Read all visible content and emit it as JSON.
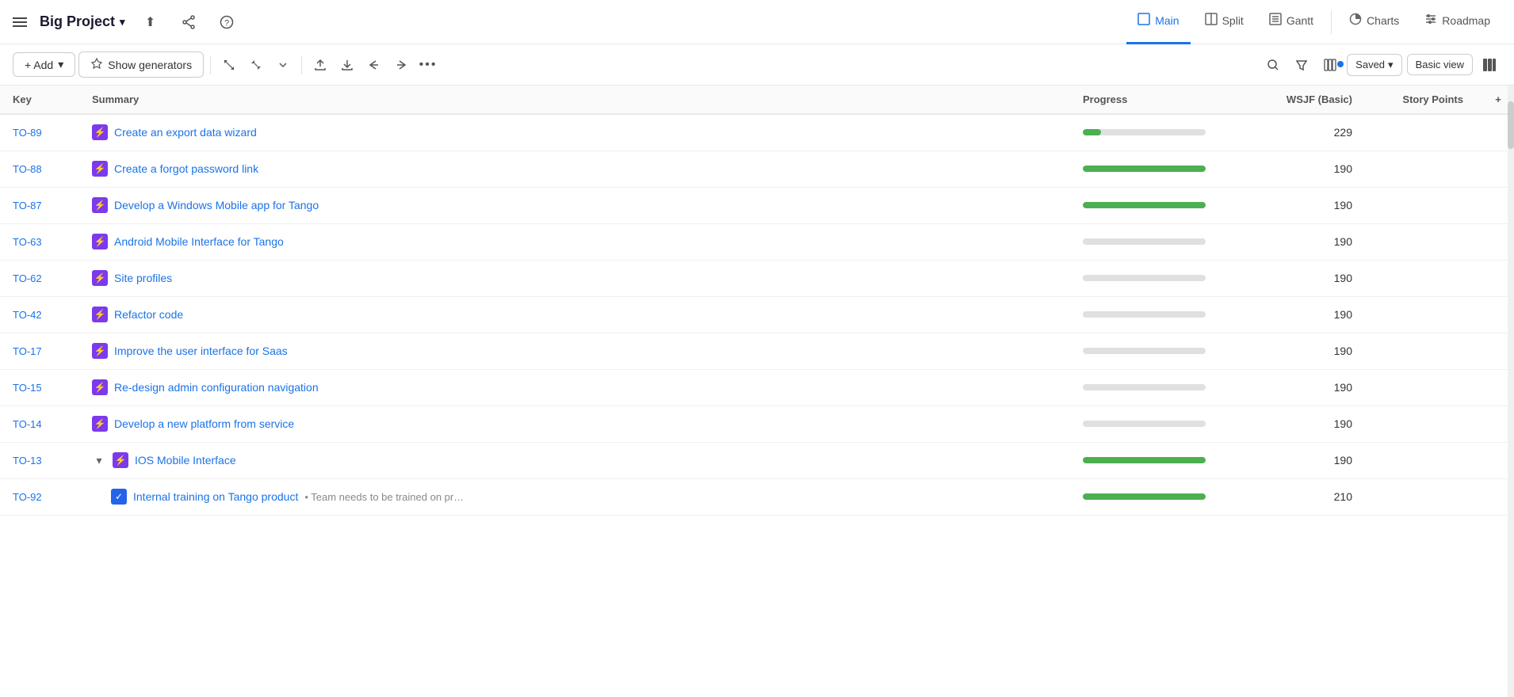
{
  "project": {
    "title": "Big Project",
    "chevron": "▾"
  },
  "topnav": {
    "upload_icon": "⬆",
    "share_icon": "⋮",
    "help_icon": "?",
    "tabs": [
      {
        "id": "main",
        "label": "Main",
        "icon": "☐",
        "active": true
      },
      {
        "id": "split",
        "label": "Split",
        "icon": "⊟",
        "active": false
      },
      {
        "id": "gantt",
        "label": "Gantt",
        "icon": "≡",
        "active": false
      },
      {
        "id": "charts",
        "label": "Charts",
        "icon": "◉",
        "active": false
      },
      {
        "id": "roadmap",
        "label": "Roadmap",
        "icon": "≔",
        "active": false
      }
    ]
  },
  "toolbar": {
    "add_label": "+ Add",
    "add_chevron": "▾",
    "generators_label": "Show generators",
    "expand_icon": "⤢",
    "collapse_icon": "⤡",
    "chevron_down": "▾",
    "upload_icon": "⬆",
    "download_icon": "⬇",
    "back_icon": "◀",
    "forward_icon": "▶",
    "more_icon": "•••",
    "search_icon": "🔍",
    "filter_icon": "⧖",
    "group_icon": "⊞",
    "saved_label": "Saved",
    "saved_chevron": "▾",
    "basic_view_label": "Basic view",
    "columns_icon": "|||"
  },
  "table": {
    "headers": {
      "key": "Key",
      "summary": "Summary",
      "progress": "Progress",
      "wsjf": "WSJF (Basic)",
      "story_points": "Story Points",
      "add": "+"
    },
    "rows": [
      {
        "key": "TO-89",
        "summary": "Create an export data wizard",
        "icon_type": "bolt",
        "progress": 15,
        "wsjf": "229",
        "story_points": "",
        "indent": false,
        "expandable": false,
        "is_subtask": false
      },
      {
        "key": "TO-88",
        "summary": "Create a forgot password link",
        "icon_type": "bolt",
        "progress": 100,
        "wsjf": "190",
        "story_points": "",
        "indent": false,
        "expandable": false,
        "is_subtask": false
      },
      {
        "key": "TO-87",
        "summary": "Develop a Windows Mobile app for Tango",
        "icon_type": "bolt",
        "progress": 100,
        "wsjf": "190",
        "story_points": "",
        "indent": false,
        "expandable": false,
        "is_subtask": false
      },
      {
        "key": "TO-63",
        "summary": "Android Mobile Interface for Tango",
        "icon_type": "bolt",
        "progress": 0,
        "wsjf": "190",
        "story_points": "",
        "indent": false,
        "expandable": false,
        "is_subtask": false
      },
      {
        "key": "TO-62",
        "summary": "Site profiles",
        "icon_type": "bolt",
        "progress": 0,
        "wsjf": "190",
        "story_points": "",
        "indent": false,
        "expandable": false,
        "is_subtask": false
      },
      {
        "key": "TO-42",
        "summary": "Refactor code",
        "icon_type": "bolt",
        "progress": 0,
        "wsjf": "190",
        "story_points": "",
        "indent": false,
        "expandable": false,
        "is_subtask": false
      },
      {
        "key": "TO-17",
        "summary": "Improve the user interface for Saas",
        "icon_type": "bolt",
        "progress": 0,
        "wsjf": "190",
        "story_points": "",
        "indent": false,
        "expandable": false,
        "is_subtask": false
      },
      {
        "key": "TO-15",
        "summary": "Re-design admin configuration navigation",
        "icon_type": "bolt",
        "progress": 0,
        "wsjf": "190",
        "story_points": "",
        "indent": false,
        "expandable": false,
        "is_subtask": false
      },
      {
        "key": "TO-14",
        "summary": "Develop a new platform from service",
        "icon_type": "bolt",
        "progress": 0,
        "wsjf": "190",
        "story_points": "",
        "indent": false,
        "expandable": false,
        "is_subtask": false
      },
      {
        "key": "TO-13",
        "summary": "IOS Mobile Interface",
        "icon_type": "bolt",
        "progress": 100,
        "wsjf": "190",
        "story_points": "",
        "indent": false,
        "expandable": true,
        "is_subtask": false
      },
      {
        "key": "TO-92",
        "summary": "Internal training on Tango product",
        "summary_sub": "• Team needs to be trained on pr…",
        "icon_type": "checkbox",
        "progress": 100,
        "wsjf": "210",
        "story_points": "",
        "indent": true,
        "expandable": false,
        "is_subtask": true
      }
    ]
  }
}
